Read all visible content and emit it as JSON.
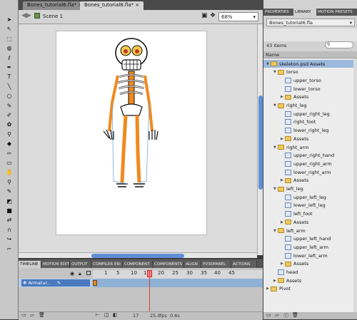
{
  "document_tabs": [
    {
      "label": "Bones_tutorial6.fla*"
    },
    {
      "label": "Bones_tutorial8.fla*"
    }
  ],
  "editbar": {
    "scene": "Scene 1",
    "zoom": "68%"
  },
  "timeline": {
    "tabs": [
      "TIMELINE",
      "MOTION EDIT",
      "OUTPUT",
      "COMPILER ERI",
      "COMPONENT",
      "COMPONENTS",
      "ALIGN",
      "PV3DPANEL",
      "ACTIONS"
    ],
    "frame_numbers": [
      "1",
      "5",
      "10",
      "15",
      "20",
      "25",
      "30",
      "35",
      "40",
      "45"
    ],
    "layer_name": "Armatur...",
    "current_frame": "17",
    "fps": "25.0",
    "fps_label": "fps",
    "time": "0.6s"
  },
  "panel": {
    "tabs": [
      "PROPERTIES",
      "LIBRARY",
      "MOTION PRESETS"
    ],
    "library_file": "Bones_tutorial6.fla",
    "items_count": "43 items",
    "column_name": "Name",
    "items": [
      {
        "label": "skeleton.psd Assets",
        "kind": "folder",
        "depth": 0,
        "open": true
      },
      {
        "label": "torso",
        "kind": "folder",
        "depth": 1,
        "open": true
      },
      {
        "label": "upper_torso",
        "kind": "symbol",
        "depth": 2
      },
      {
        "label": "lower_torso",
        "kind": "symbol",
        "depth": 2
      },
      {
        "label": "Assets",
        "kind": "folder",
        "depth": 2,
        "open": false
      },
      {
        "label": "right_leg",
        "kind": "folder",
        "depth": 1,
        "open": true
      },
      {
        "label": "upper_right_leg",
        "kind": "symbol",
        "depth": 2
      },
      {
        "label": "right_foot",
        "kind": "symbol",
        "depth": 2
      },
      {
        "label": "lower_right_leg",
        "kind": "symbol",
        "depth": 2
      },
      {
        "label": "Assets",
        "kind": "folder",
        "depth": 2,
        "open": false
      },
      {
        "label": "right_arm",
        "kind": "folder",
        "depth": 1,
        "open": true
      },
      {
        "label": "upper_right_hand",
        "kind": "symbol",
        "depth": 2
      },
      {
        "label": "upper_right_arm",
        "kind": "symbol",
        "depth": 2
      },
      {
        "label": "lower_right_arm",
        "kind": "symbol",
        "depth": 2
      },
      {
        "label": "Assets",
        "kind": "folder",
        "depth": 2,
        "open": false
      },
      {
        "label": "left_leg",
        "kind": "folder",
        "depth": 1,
        "open": true
      },
      {
        "label": "upper_left_leg",
        "kind": "symbol",
        "depth": 2
      },
      {
        "label": "lower_left_leg",
        "kind": "symbol",
        "depth": 2
      },
      {
        "label": "left_foot",
        "kind": "symbol",
        "depth": 2
      },
      {
        "label": "Assets",
        "kind": "folder",
        "depth": 2,
        "open": false
      },
      {
        "label": "left_arm",
        "kind": "folder",
        "depth": 1,
        "open": true
      },
      {
        "label": "upper_left_hand",
        "kind": "symbol",
        "depth": 2
      },
      {
        "label": "upper_left_arm",
        "kind": "symbol",
        "depth": 2
      },
      {
        "label": "lower_left_arm",
        "kind": "symbol",
        "depth": 2
      },
      {
        "label": "Assets",
        "kind": "folder",
        "depth": 2,
        "open": false
      },
      {
        "label": "head",
        "kind": "symbol",
        "depth": 1
      },
      {
        "label": "Assets",
        "kind": "folder",
        "depth": 1,
        "open": false
      },
      {
        "label": "Pivot",
        "kind": "folder",
        "depth": 0,
        "open": false
      }
    ]
  },
  "tools": [
    {
      "icon": "selection-arrow-icon",
      "glyph": "➤"
    },
    {
      "icon": "subselection-icon",
      "glyph": "↖"
    },
    {
      "icon": "free-transform-icon",
      "glyph": "⬚"
    },
    {
      "icon": "3d-rotation-icon",
      "glyph": "◍"
    },
    {
      "icon": "lasso-icon",
      "glyph": "ℓ"
    },
    {
      "icon": "pen-icon",
      "glyph": "✒"
    },
    {
      "icon": "text-icon",
      "glyph": "T"
    },
    {
      "icon": "line-icon",
      "glyph": "╲"
    },
    {
      "icon": "rectangle-icon",
      "glyph": "○"
    },
    {
      "icon": "pencil-icon",
      "glyph": "✎"
    },
    {
      "icon": "brush-icon",
      "glyph": "✐"
    },
    {
      "icon": "deco-icon",
      "glyph": "✿"
    },
    {
      "icon": "bone-icon",
      "glyph": "⚲"
    },
    {
      "icon": "paint-bucket-icon",
      "glyph": "◆"
    },
    {
      "icon": "eyedropper-icon",
      "glyph": "✑"
    },
    {
      "icon": "eraser-icon",
      "glyph": "▭"
    },
    {
      "icon": "hand-icon",
      "glyph": "✋"
    },
    {
      "icon": "zoom-icon",
      "glyph": "⚲"
    },
    {
      "icon": "stroke-color-icon",
      "glyph": "✎"
    },
    {
      "icon": "fill-color-icon",
      "glyph": "◩"
    },
    {
      "icon": "black-white-icon",
      "glyph": "■"
    },
    {
      "icon": "swap-colors-icon",
      "glyph": "⇄"
    },
    {
      "icon": "snap-icon",
      "glyph": "∩"
    },
    {
      "icon": "smooth-icon",
      "glyph": "↪"
    },
    {
      "icon": "straighten-icon",
      "glyph": "⌐"
    }
  ],
  "colors": {
    "accent_blue": "#5f8fd6",
    "skeleton_bone": "#f08a1e",
    "playhead": "#e03a3a"
  }
}
